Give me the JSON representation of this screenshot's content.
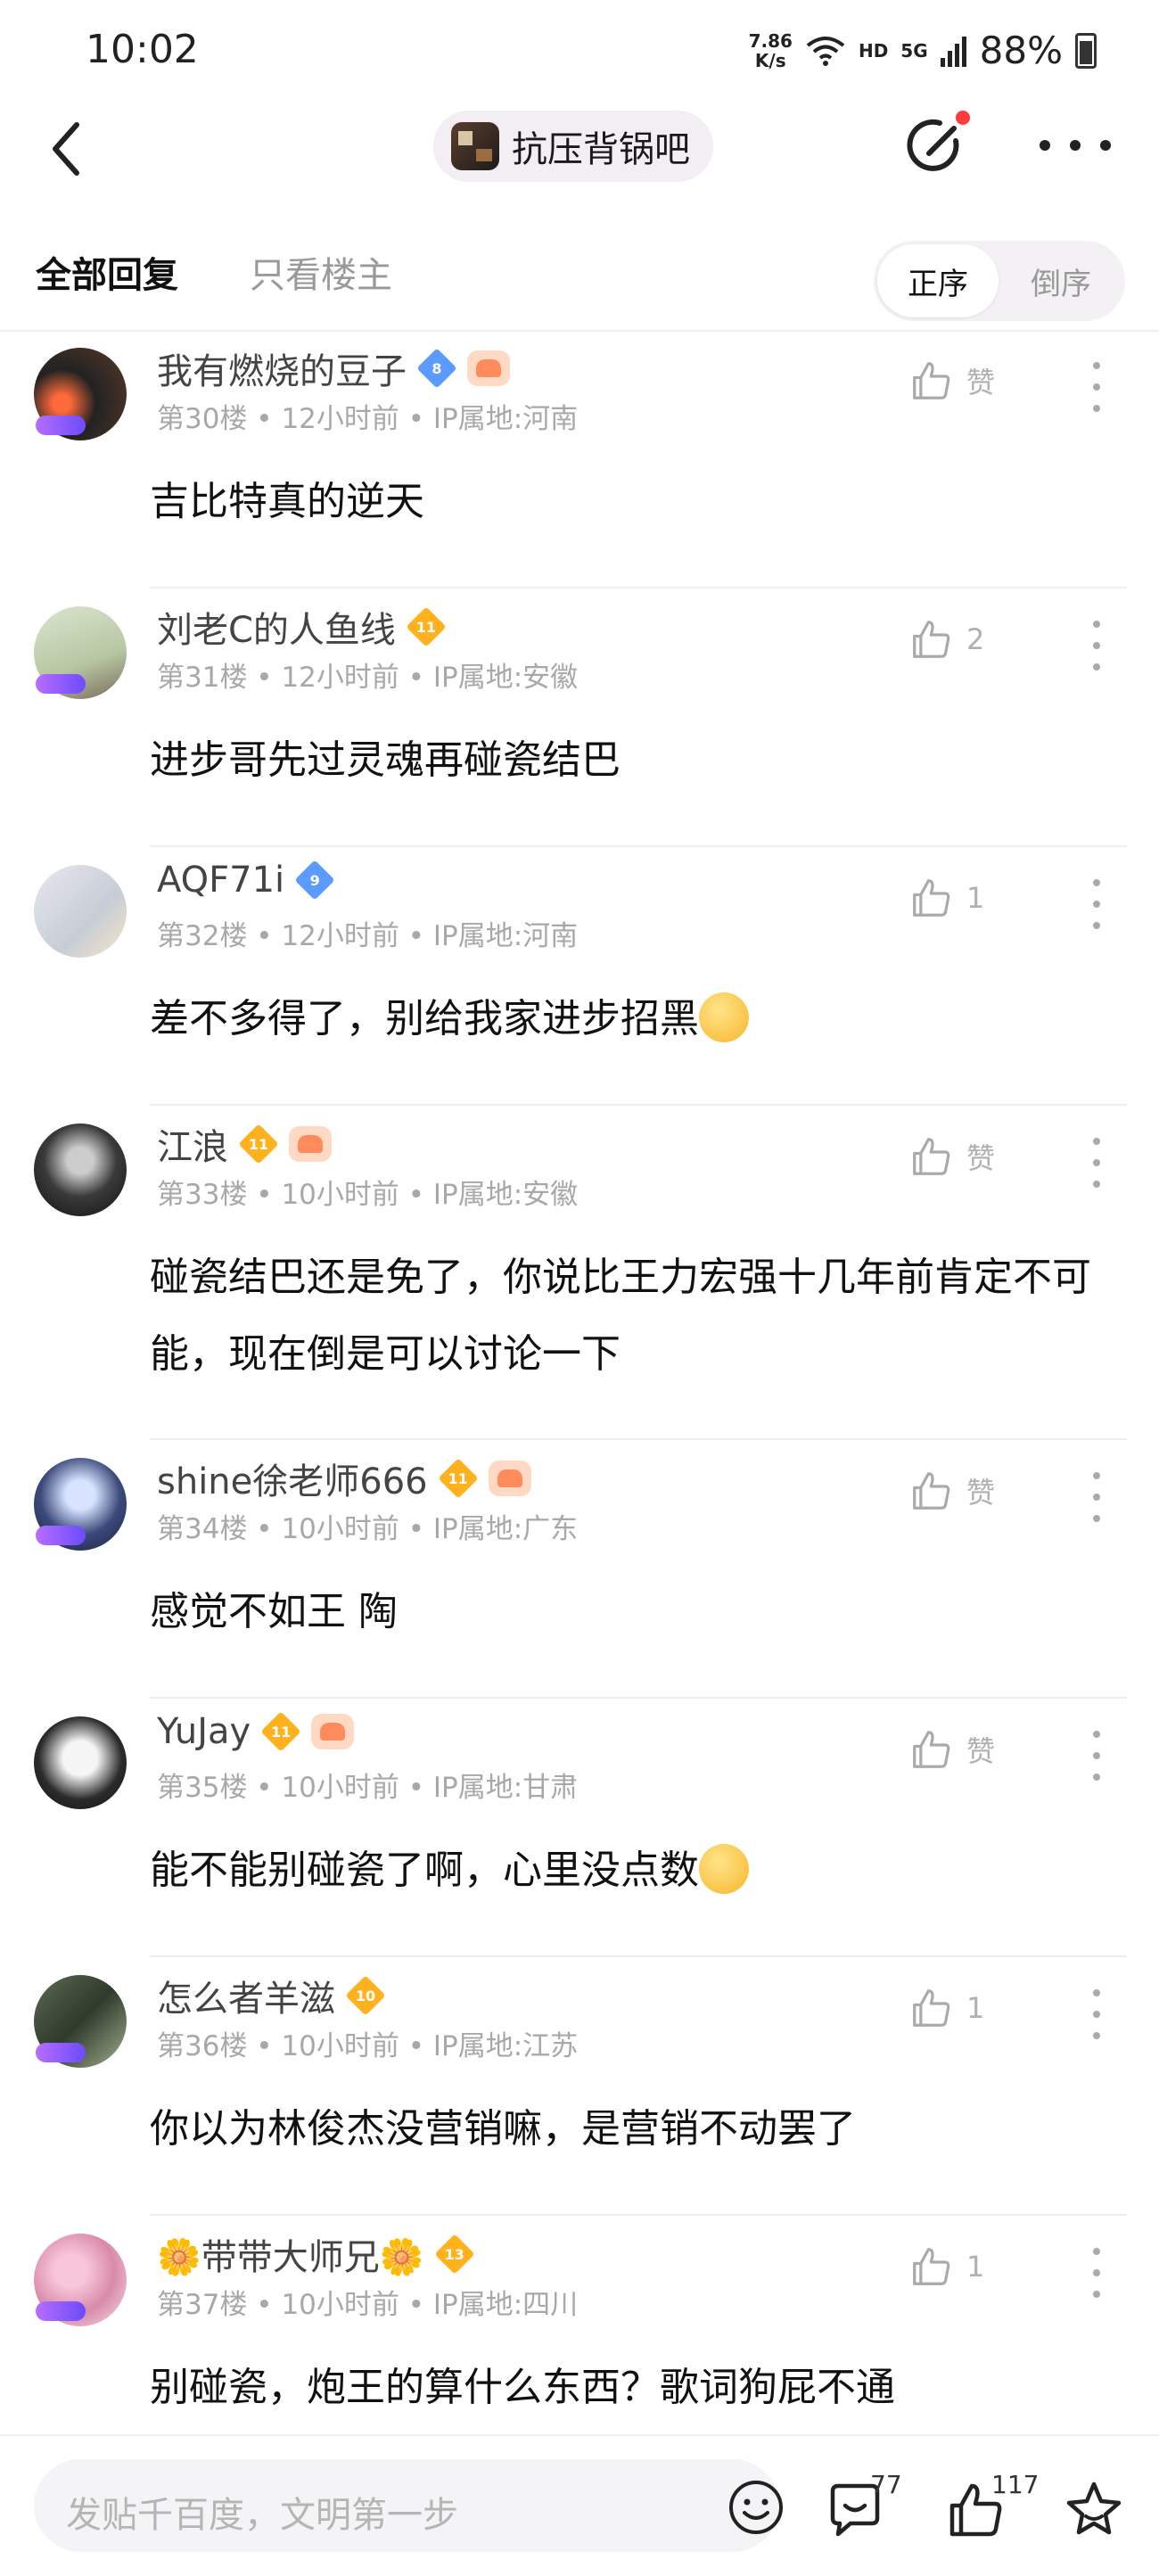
{
  "status_bar": {
    "time": "10:02",
    "net_speed_value": "7.86",
    "net_speed_unit": "K/s",
    "hd": "HD",
    "signal": "5G",
    "battery": "88%"
  },
  "nav": {
    "forum_name": "抗压背锅吧"
  },
  "tabs": {
    "all": "全部回复",
    "owner_only": "只看楼主",
    "order_asc": "正序",
    "order_desc": "倒序"
  },
  "replies": [
    {
      "username": "我有燃烧的豆子",
      "level": "8",
      "level_color": "blue",
      "extra_badge": true,
      "floor": "第30楼",
      "time": "12小时前",
      "ip": "IP属地:河南",
      "likes": "赞",
      "content": "吉比特真的逆天",
      "emoji": false
    },
    {
      "username": "刘老C的人鱼线",
      "level": "11",
      "level_color": "gold",
      "extra_badge": false,
      "floor": "第31楼",
      "time": "12小时前",
      "ip": "IP属地:安徽",
      "likes": "2",
      "content": "进步哥先过灵魂再碰瓷结巴",
      "emoji": false
    },
    {
      "username": "AQF71i",
      "level": "9",
      "level_color": "blue",
      "extra_badge": false,
      "floor": "第32楼",
      "time": "12小时前",
      "ip": "IP属地:河南",
      "likes": "1",
      "content": "差不多得了，别给我家进步招黑",
      "emoji": true
    },
    {
      "username": "江浪",
      "level": "11",
      "level_color": "gold",
      "extra_badge": true,
      "floor": "第33楼",
      "time": "10小时前",
      "ip": "IP属地:安徽",
      "likes": "赞",
      "content": "碰瓷结巴还是免了，你说比王力宏强十几年前肯定不可能，现在倒是可以讨论一下",
      "emoji": false
    },
    {
      "username": "shine徐老师666",
      "level": "11",
      "level_color": "gold",
      "extra_badge": true,
      "floor": "第34楼",
      "time": "10小时前",
      "ip": "IP属地:广东",
      "likes": "赞",
      "content": "感觉不如王 陶",
      "emoji": false
    },
    {
      "username": "YuJay",
      "level": "11",
      "level_color": "gold",
      "extra_badge": true,
      "floor": "第35楼",
      "time": "10小时前",
      "ip": "IP属地:甘肃",
      "likes": "赞",
      "content": "能不能别碰瓷了啊，心里没点数",
      "emoji": true
    },
    {
      "username": "怎么者羊滋",
      "level": "10",
      "level_color": "gold",
      "extra_badge": false,
      "floor": "第36楼",
      "time": "10小时前",
      "ip": "IP属地:江苏",
      "likes": "1",
      "content": "你以为林俊杰没营销嘛，是营销不动罢了",
      "emoji": false
    },
    {
      "username": "🌼带带大师兄🌼",
      "level": "13",
      "level_color": "gold",
      "extra_badge": false,
      "floor": "第37楼",
      "time": "10小时前",
      "ip": "IP属地:四川",
      "likes": "1",
      "content": "别碰瓷，炮王的算什么东西？歌词狗屁不通",
      "emoji": false
    }
  ],
  "bottom": {
    "input_placeholder": "发贴千百度，文明第一步",
    "comments_count": "77",
    "likes_count": "117"
  },
  "colors": {
    "accent_red": "#ff3b3b",
    "level_blue": "#5b9bff",
    "level_gold": "#ffb21e",
    "meta_gray": "#a8a8a8"
  }
}
